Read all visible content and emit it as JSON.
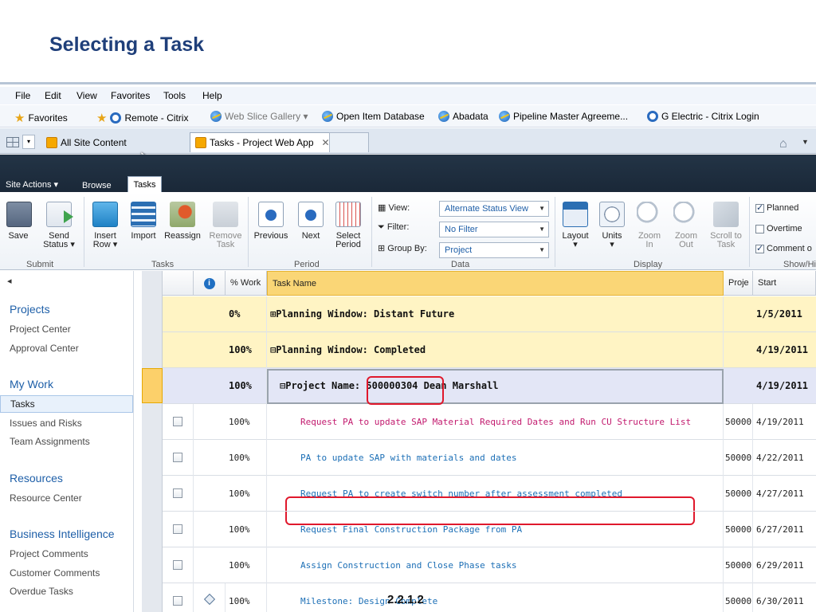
{
  "slide": {
    "title": "Selecting a Task",
    "page_number": "2.2.1.2"
  },
  "menubar": {
    "items": [
      "File",
      "Edit",
      "View",
      "Favorites",
      "Tools",
      "Help"
    ]
  },
  "favorites": {
    "label": "Favorites",
    "items": [
      "Remote - Citrix",
      "Web Slice Gallery ▾",
      "Open Item Database",
      "Abadata",
      "Pipeline Master Agreeme...",
      "G Electric - Citrix Login"
    ]
  },
  "tabs": {
    "tab1": "All Site Content",
    "tab2": "Tasks - Project Web App",
    "close": "✕"
  },
  "sharepoint": {
    "site_actions": "Site Actions ▾",
    "browse": "Browse",
    "tasks": "Tasks"
  },
  "ribbon": {
    "save": "Save",
    "send_status": [
      "Send",
      "Status ▾"
    ],
    "insert_row": [
      "Insert",
      "Row ▾"
    ],
    "import": "Import",
    "reassign": "Reassign",
    "remove_task": [
      "Remove",
      "Task"
    ],
    "previous": "Previous",
    "next": "Next",
    "select_period": [
      "Select",
      "Period"
    ],
    "view_label": "View:",
    "view_value": "Alternate Status View",
    "filter_label": "Filter:",
    "filter_value": "No Filter",
    "groupby_label": "Group By:",
    "groupby_value": "Project",
    "layout": "Layout",
    "units": "Units",
    "zoom_in": [
      "Zoom",
      "In"
    ],
    "zoom_out": [
      "Zoom",
      "Out"
    ],
    "scroll_to_task": [
      "Scroll to",
      "Task"
    ],
    "planned": "Planned",
    "overtime": "Overtime",
    "comment": "Comment o",
    "groups": {
      "submit": "Submit",
      "tasks": "Tasks",
      "period": "Period",
      "data": "Data",
      "display": "Display",
      "show_hide": "Show/Hi"
    }
  },
  "leftnav": {
    "back": "◂",
    "sections": [
      {
        "heading": "Projects",
        "items": [
          "Project Center",
          "Approval Center"
        ]
      },
      {
        "heading": "My Work",
        "items": [
          "Tasks",
          "Issues and Risks",
          "Team Assignments"
        ]
      },
      {
        "heading": "Resources",
        "items": [
          "Resource Center"
        ]
      },
      {
        "heading": "Business Intelligence",
        "items": [
          "Project Comments",
          "Customer Comments",
          "Overdue Tasks"
        ]
      }
    ]
  },
  "grid": {
    "headers": {
      "pct_work": "% Work",
      "task_name": "Task Name",
      "project": "Proje",
      "start": "Start"
    },
    "rows": [
      {
        "type": "summary",
        "pct": "0%",
        "name": "⊞Planning Window: Distant Future",
        "project": "",
        "start": "1/5/2011"
      },
      {
        "type": "summary",
        "pct": "100%",
        "name": "⊟Planning Window: Completed",
        "project": "",
        "start": "4/19/2011"
      },
      {
        "type": "project",
        "pct": "100%",
        "name": "⊟Project Name: 500000304 Dean Marshall",
        "project": "",
        "start": "4/19/2011"
      },
      {
        "type": "task",
        "pct": "100%",
        "name": "Request PA to update SAP Material Required Dates and Run CU Structure List",
        "project": "50000",
        "start": "4/19/2011"
      },
      {
        "type": "task",
        "pct": "100%",
        "name": "PA to update SAP with materials and dates",
        "project": "50000",
        "start": "4/22/2011"
      },
      {
        "type": "task",
        "pct": "100%",
        "name": "Request PA to create switch number after assessment completed",
        "project": "50000",
        "start": "4/27/2011"
      },
      {
        "type": "task",
        "pct": "100%",
        "name": "Request Final Construction Package from PA",
        "project": "50000",
        "start": "6/27/2011"
      },
      {
        "type": "task",
        "pct": "100%",
        "name": "Assign Construction and Close Phase tasks",
        "project": "50000",
        "start": "6/29/2011"
      },
      {
        "type": "milestone",
        "pct": "100%",
        "name": "Milestone: Design Complete",
        "project": "50000",
        "start": "6/30/2011"
      }
    ]
  },
  "colors": {
    "title": "#1f3f7a",
    "highlight": "#e0182c",
    "summary_row": "#fff4c4",
    "task_link": "#1c6fb6"
  }
}
